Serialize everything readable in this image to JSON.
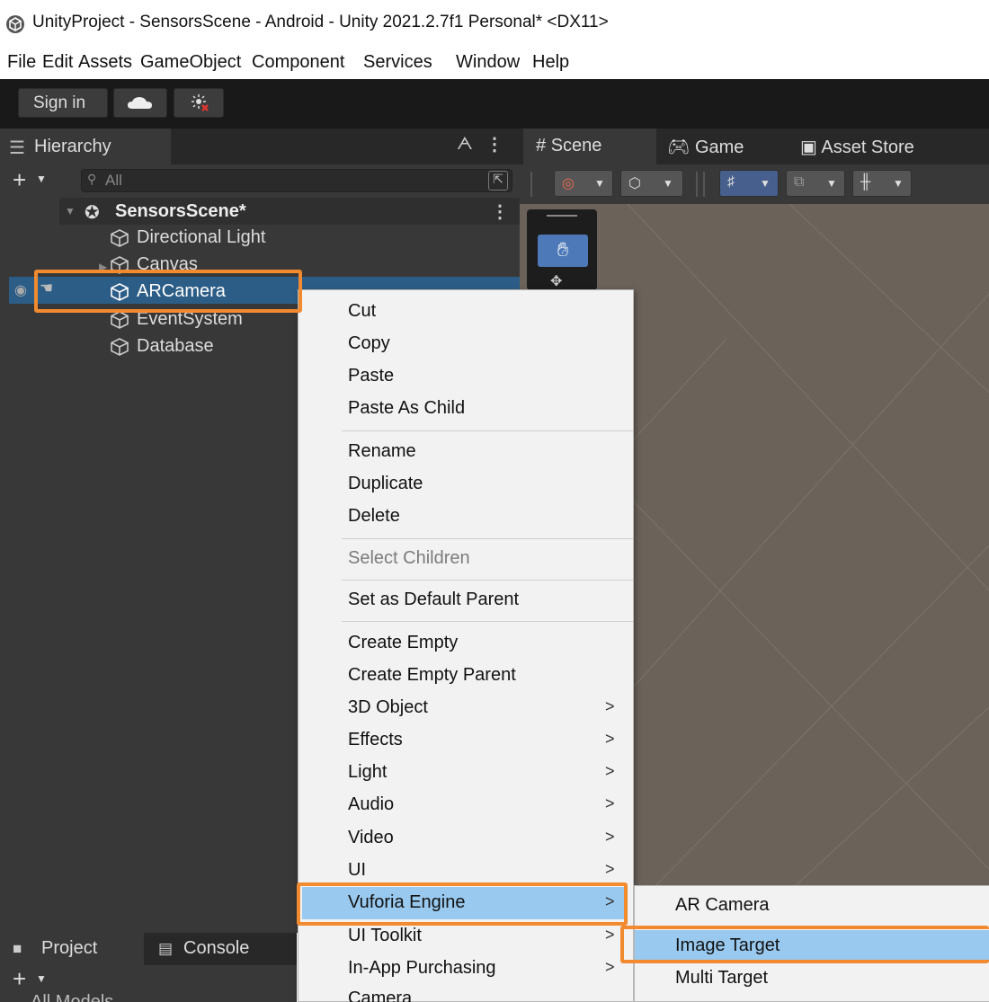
{
  "window": {
    "title": "UnityProject - SensorsScene - Android - Unity 2021.2.7f1 Personal* <DX11>"
  },
  "menu": [
    "File",
    "Edit",
    "Assets",
    "GameObject",
    "Component",
    "Services",
    "Window",
    "Help"
  ],
  "toolbar": {
    "sign_in": "Sign in"
  },
  "hierarchy": {
    "tab": "Hierarchy",
    "search_placeholder": "All",
    "scene": "SensorsScene*",
    "items": [
      "Directional Light",
      "Canvas",
      "ARCamera",
      "EventSystem",
      "Database"
    ],
    "selected": "ARCamera"
  },
  "scene_view": {
    "tabs": [
      "Scene",
      "Game",
      "Asset Store"
    ]
  },
  "bottom": {
    "tabs": [
      "Project",
      "Console"
    ],
    "partial_text": "All Models"
  },
  "context_menu": {
    "items": [
      {
        "label": "Cut"
      },
      {
        "label": "Copy"
      },
      {
        "label": "Paste"
      },
      {
        "label": "Paste As Child"
      },
      {
        "label": "Rename"
      },
      {
        "label": "Duplicate"
      },
      {
        "label": "Delete"
      },
      {
        "label": "Select Children",
        "disabled": true
      },
      {
        "label": "Set as Default Parent"
      },
      {
        "label": "Create Empty"
      },
      {
        "label": "Create Empty Parent"
      },
      {
        "label": "3D Object",
        "submenu": true
      },
      {
        "label": "Effects",
        "submenu": true
      },
      {
        "label": "Light",
        "submenu": true
      },
      {
        "label": "Audio",
        "submenu": true
      },
      {
        "label": "Video",
        "submenu": true
      },
      {
        "label": "UI",
        "submenu": true
      },
      {
        "label": "Vuforia Engine",
        "submenu": true,
        "active": true
      },
      {
        "label": "UI Toolkit",
        "submenu": true
      },
      {
        "label": "In-App Purchasing",
        "submenu": true
      },
      {
        "label": "Camera"
      }
    ],
    "arrow": ">"
  },
  "submenu": {
    "items": [
      "AR Camera",
      "Image Target",
      "Multi Target"
    ],
    "active": "Image Target"
  },
  "colors": {
    "highlight_outline": "#f28a30",
    "menu_selection": "#99c9ef",
    "hierarchy_selection": "#2c5d87",
    "editor_dark": "#383838",
    "scene_bg": "#6b625a"
  }
}
